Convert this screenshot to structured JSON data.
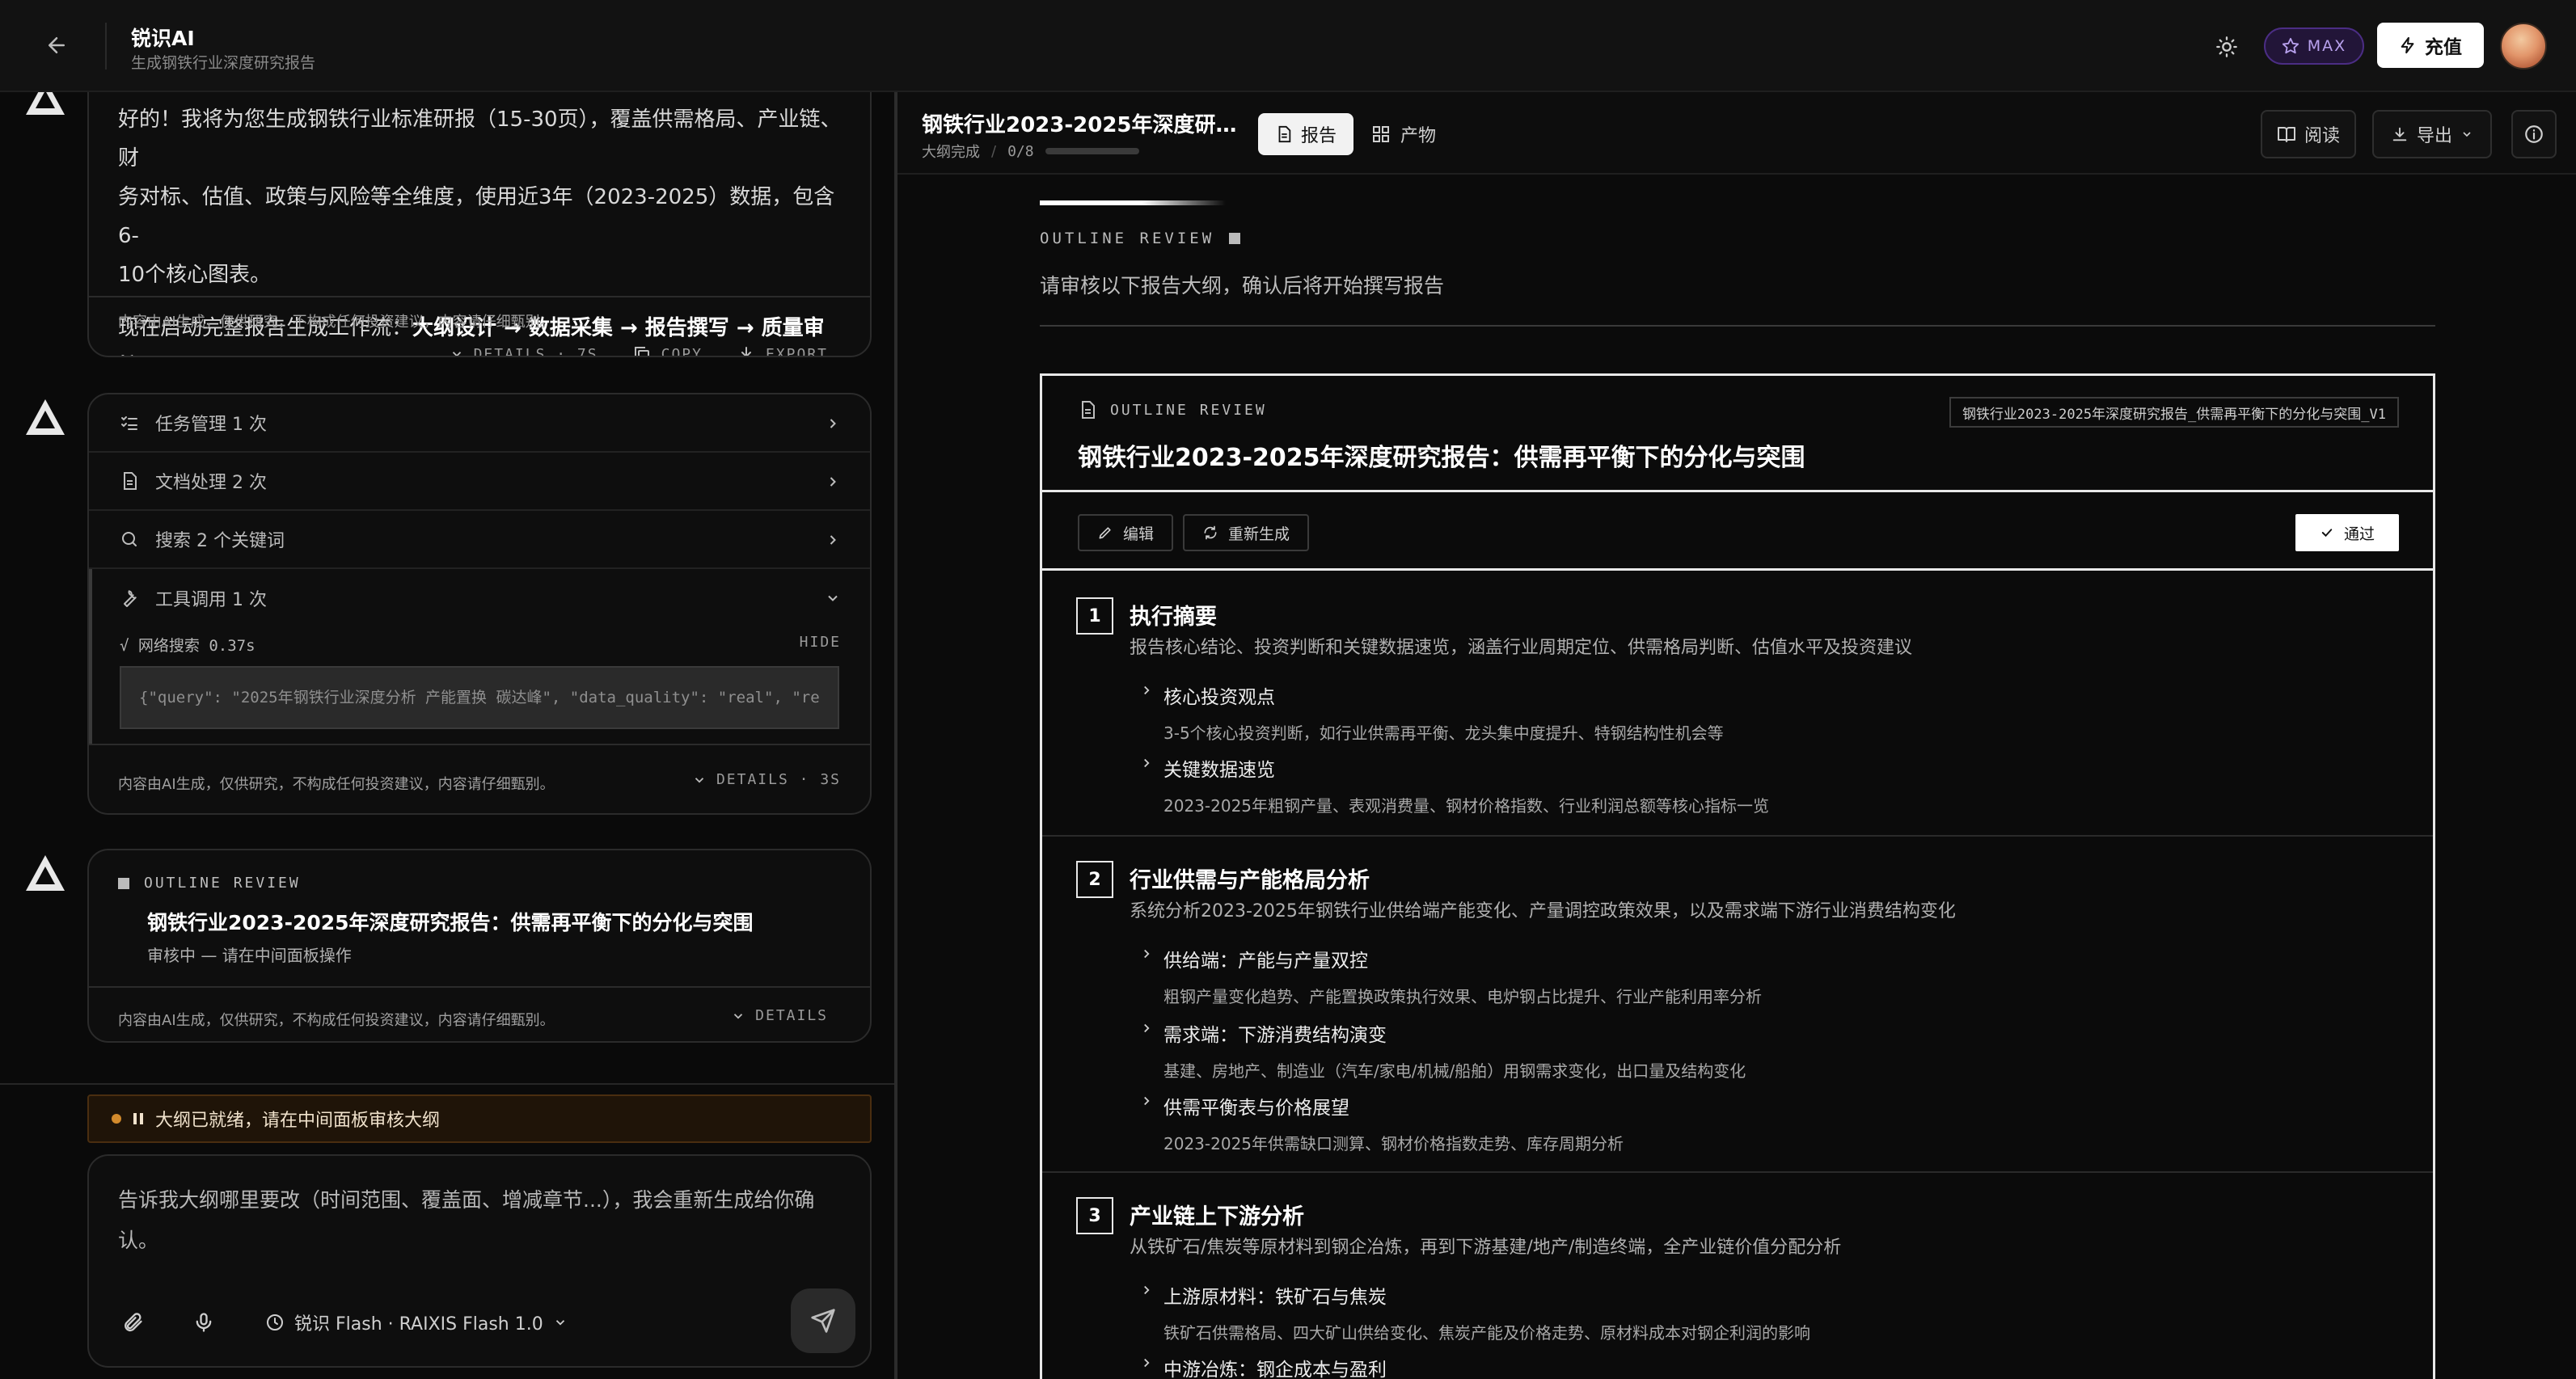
{
  "header": {
    "app_title": "锐识AI",
    "app_subtitle": "生成钢铁行业深度研究报告",
    "max_label": "MAX",
    "recharge_label": "充值"
  },
  "chat": {
    "msg1": {
      "line1": "好的！我将为您生成钢铁行业标准研报（15-30页），覆盖供需格局、产业链、财",
      "line2": "务对标、估值、政策与风险等全维度，使用近3年（2023-2025）数据，包含6-",
      "line3": "10个核心图表。",
      "workflow_prefix": "现在启动完整报告生成工作流：",
      "workflow_steps": "大纲设计 → 数据采集 → 报告撰写 → 质量审核",
      "workflow_suffix": "。",
      "disclaimer": "内容由AI生成，仅供研究，不构成任何投资建议，内容请仔细甄别。",
      "details_label": "DETAILS · 7S",
      "copy_label": "COPY",
      "export_label": "EXPORT"
    },
    "msg2": {
      "tools": [
        {
          "label": "任务管理 1 次"
        },
        {
          "label": "文档处理 2 次"
        },
        {
          "label": "搜索 2 个关键词"
        },
        {
          "label": "工具调用 1 次"
        }
      ],
      "tool_detail_name": "√ 网络搜索 0.37s",
      "hide_label": "HIDE",
      "tool_output": "{\"query\": \"2025年钢铁行业深度分析 产能置换 碳达峰\", \"data_quality\": \"real\", \"re",
      "disclaimer": "内容由AI生成，仅供研究，不构成任何投资建议，内容请仔细甄别。",
      "details_label": "DETAILS · 3S"
    },
    "msg3": {
      "kicker": "OUTLINE REVIEW",
      "title": "钢铁行业2023-2025年深度研究报告：供需再平衡下的分化与突围",
      "status": "审核中 — 请在中间面板操作",
      "disclaimer": "内容由AI生成，仅供研究，不构成任何投资建议，内容请仔细甄别。",
      "details_label": "DETAILS"
    },
    "status_bar": "大纲已就绪，请在中间面板审核大纲",
    "composer": {
      "text": "告诉我大纲哪里要改（时间范围、覆盖面、增减章节...），我会重新生成给你确认。",
      "model_label": "锐识 Flash · RAIXIS Flash 1.0"
    }
  },
  "report": {
    "title": "钢铁行业2023-2025年深度研究报告：供需再平衡下的分化与突围",
    "status": "大纲完成",
    "progress_text": "0/8",
    "progress": 0,
    "tab_report": "报告",
    "tab_artifact": "产物",
    "read_label": "阅读",
    "export_label": "导出",
    "review_kicker": "OUTLINE REVIEW",
    "review_desc": "请审核以下报告大纲，确认后将开始撰写报告",
    "outline": {
      "kicker": "OUTLINE REVIEW",
      "title": "钢铁行业2023-2025年深度研究报告：供需再平衡下的分化与突围",
      "version_tag": "钢铁行业2023-2025年深度研究报告_供需再平衡下的分化与突围_V1",
      "edit_label": "编辑",
      "regen_label": "重新生成",
      "pass_label": "通过",
      "sections": [
        {
          "num": "1",
          "title": "执行摘要",
          "desc": "报告核心结论、投资判断和关键数据速览，涵盖行业周期定位、供需格局判断、估值水平及投资建议",
          "subs": [
            {
              "title": "核心投资观点",
              "desc": "3-5个核心投资判断，如行业供需再平衡、龙头集中度提升、特钢结构性机会等"
            },
            {
              "title": "关键数据速览",
              "desc": "2023-2025年粗钢产量、表观消费量、钢材价格指数、行业利润总额等核心指标一览"
            }
          ]
        },
        {
          "num": "2",
          "title": "行业供需与产能格局分析",
          "desc": "系统分析2023-2025年钢铁行业供给端产能变化、产量调控政策效果，以及需求端下游行业消费结构变化",
          "subs": [
            {
              "title": "供给端：产能与产量双控",
              "desc": "粗钢产量变化趋势、产能置换政策执行效果、电炉钢占比提升、行业产能利用率分析"
            },
            {
              "title": "需求端：下游消费结构演变",
              "desc": "基建、房地产、制造业（汽车/家电/机械/船舶）用钢需求变化，出口量及结构变化"
            },
            {
              "title": "供需平衡表与价格展望",
              "desc": "2023-2025年供需缺口测算、钢材价格指数走势、库存周期分析"
            }
          ]
        },
        {
          "num": "3",
          "title": "产业链上下游分析",
          "desc": "从铁矿石/焦炭等原材料到钢企冶炼，再到下游基建/地产/制造终端，全产业链价值分配分析",
          "subs": [
            {
              "title": "上游原材料：铁矿石与焦炭",
              "desc": "铁矿石供需格局、四大矿山供给变化、焦炭产能及价格走势、原材料成本对钢企利润的影响"
            },
            {
              "title": "中游冶炼：钢企成本与盈利",
              "desc": ""
            }
          ]
        }
      ]
    }
  }
}
